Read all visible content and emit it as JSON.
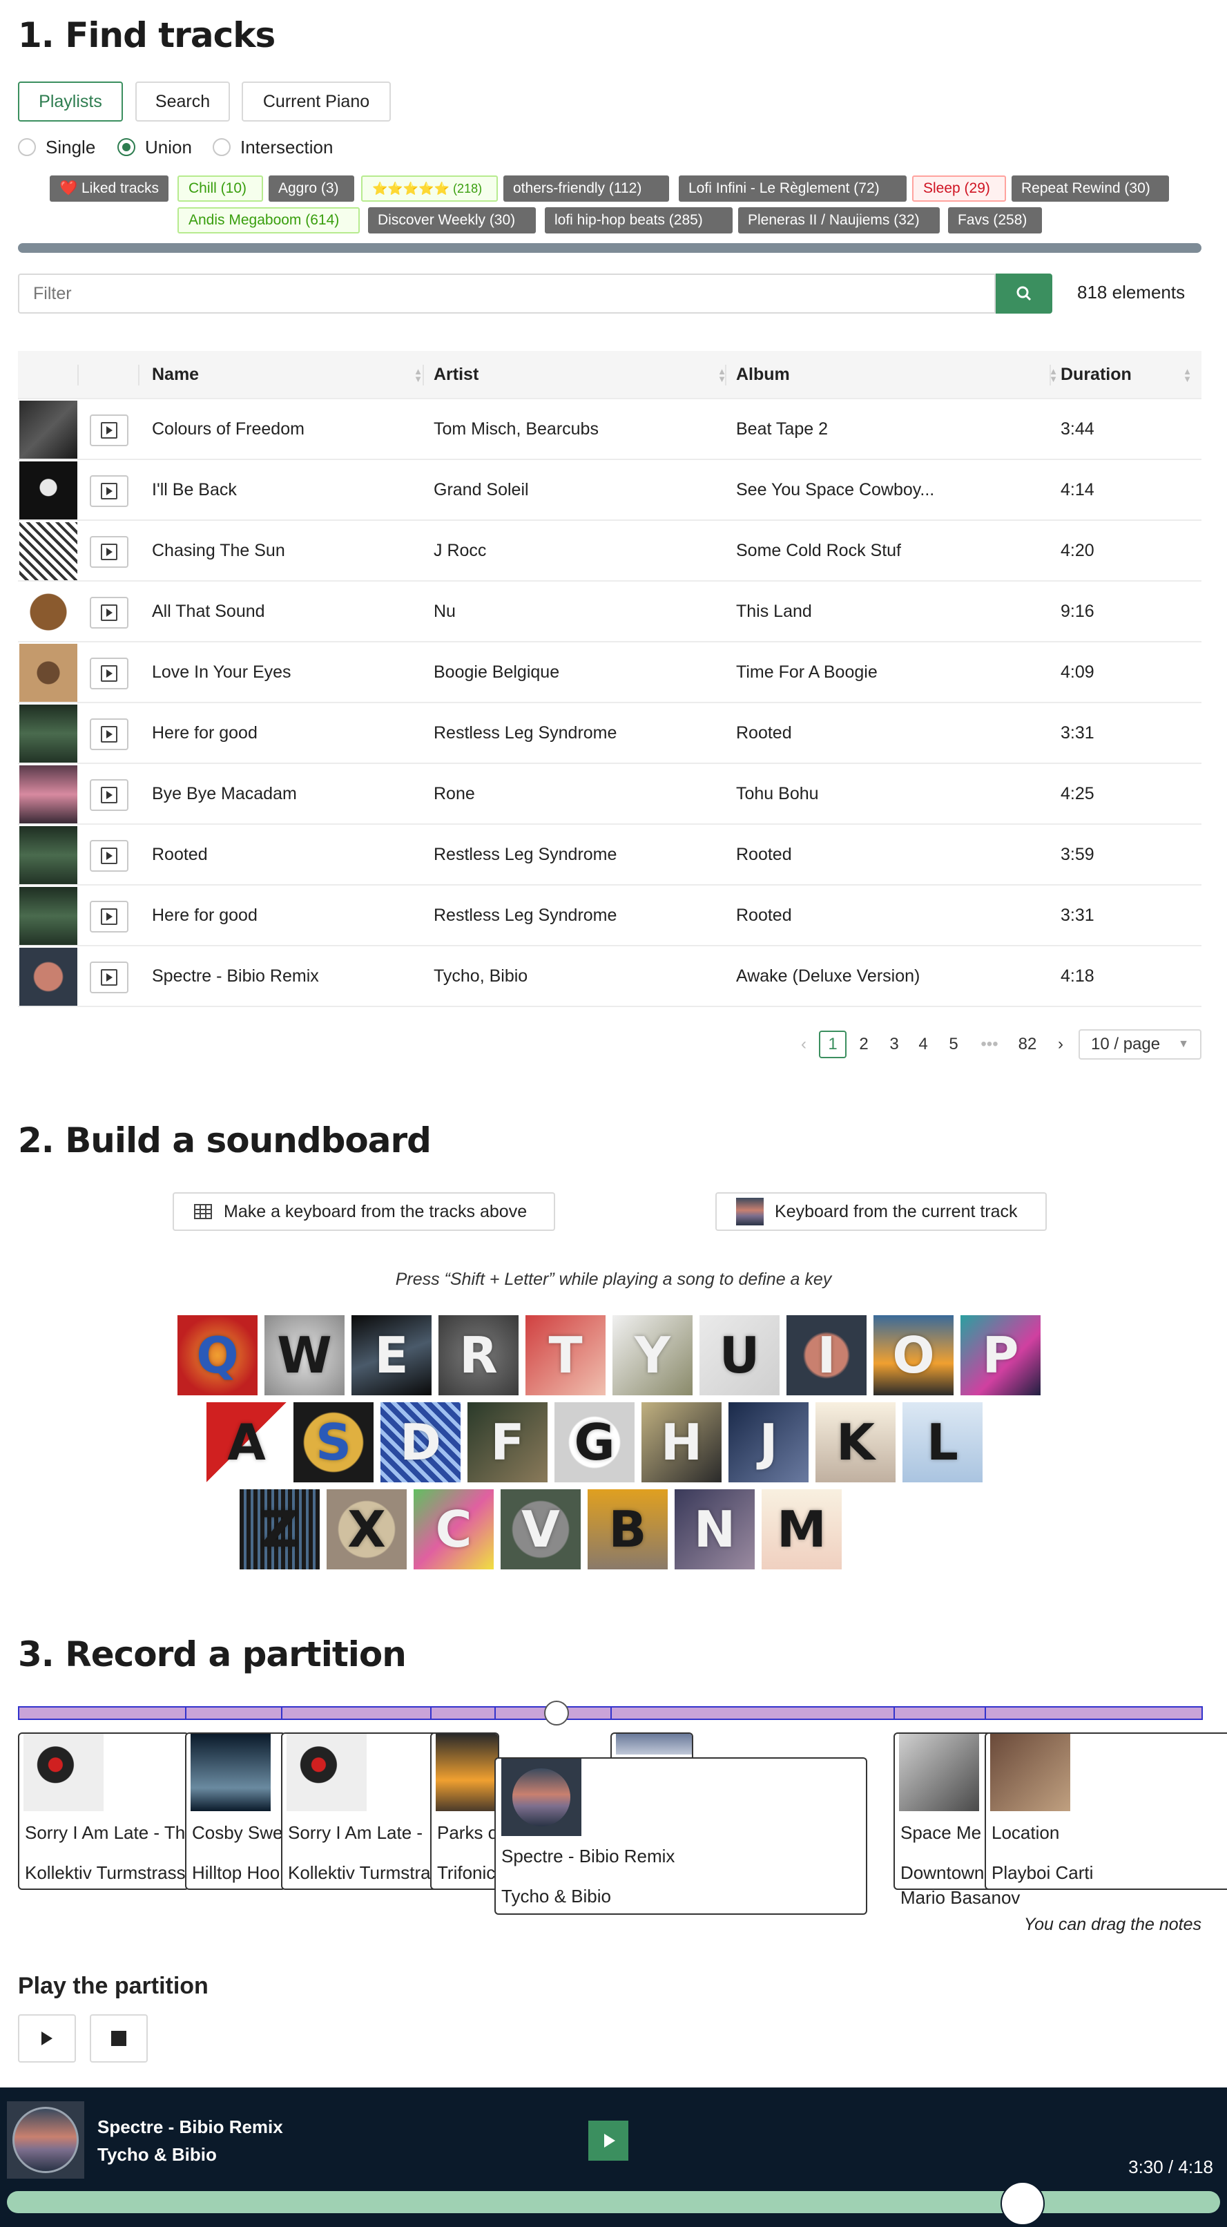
{
  "find": {
    "title": "1. Find tracks",
    "tabs": [
      "Playlists",
      "Search",
      "Current Piano"
    ],
    "modes": [
      "Single",
      "Union",
      "Intersection"
    ],
    "selected_mode": "Union",
    "tags": [
      "❤️ Liked tracks",
      "Chill (10)",
      "Aggro (3)",
      "⭐⭐⭐⭐⭐ (218)",
      "others-friendly (112)",
      "Lofi Infini - Le Règlement (72)",
      "Sleep (29)",
      "Repeat Rewind (30)",
      "Andis Megaboom (614)",
      "Discover Weekly (30)",
      "lofi hip-hop beats (285)",
      "Pleneras II / Naujiems (32)",
      "Favs (258)"
    ],
    "filter_placeholder": "Filter",
    "count": "818 elements",
    "columns": [
      "Name",
      "Artist",
      "Album",
      "Duration"
    ],
    "rows": [
      {
        "name": "Colours of Freedom",
        "artist": "Tom Misch, Bearcubs",
        "album": "Beat Tape 2",
        "duration": "3:44"
      },
      {
        "name": "I'll Be Back",
        "artist": "Grand Soleil",
        "album": "See You Space Cowboy...",
        "duration": "4:14"
      },
      {
        "name": "Chasing The Sun",
        "artist": "J Rocc",
        "album": "Some Cold Rock Stuf",
        "duration": "4:20"
      },
      {
        "name": "All That Sound",
        "artist": "Nu",
        "album": "This Land",
        "duration": "9:16"
      },
      {
        "name": "Love In Your Eyes",
        "artist": "Boogie Belgique",
        "album": "Time For A Boogie",
        "duration": "4:09"
      },
      {
        "name": "Here for good",
        "artist": "Restless Leg Syndrome",
        "album": "Rooted",
        "duration": "3:31"
      },
      {
        "name": "Bye Bye Macadam",
        "artist": "Rone",
        "album": "Tohu Bohu",
        "duration": "4:25"
      },
      {
        "name": "Rooted",
        "artist": "Restless Leg Syndrome",
        "album": "Rooted",
        "duration": "3:59"
      },
      {
        "name": "Here for good",
        "artist": "Restless Leg Syndrome",
        "album": "Rooted",
        "duration": "3:31"
      },
      {
        "name": "Spectre - Bibio Remix",
        "artist": "Tycho, Bibio",
        "album": "Awake (Deluxe Version)",
        "duration": "4:18"
      }
    ],
    "pagination": {
      "pages": [
        "1",
        "2",
        "3",
        "4",
        "5",
        "•••",
        "82"
      ],
      "current": "1",
      "page_size": "10 / page"
    }
  },
  "soundboard": {
    "title": "2. Build a soundboard",
    "make_keyboard_label": "Make a keyboard from the tracks above",
    "keyboard_current_label": "Keyboard from the current track",
    "hint": "Press “Shift + Letter” while playing a song to define a key",
    "rows": [
      [
        "Q",
        "W",
        "E",
        "R",
        "T",
        "Y",
        "U",
        "I",
        "O",
        "P"
      ],
      [
        "A",
        "S",
        "D",
        "F",
        "G",
        "H",
        "J",
        "K",
        "L"
      ],
      [
        "Z",
        "X",
        "C",
        "V",
        "B",
        "N",
        "M"
      ]
    ]
  },
  "partition": {
    "title": "3. Record a partition",
    "notes": [
      {
        "title": "Sorry I Am Late - Th",
        "artist": "Kollektiv Turmstrass"
      },
      {
        "title": "Cosby Swe",
        "artist": "Hilltop Hoo"
      },
      {
        "title": "Sorry I Am Late -",
        "artist": "Kollektiv Turmstra"
      },
      {
        "title": "Parks o",
        "artist": "Trifonic"
      },
      {
        "title": "Space Me",
        "artist": "Downtown",
        "extra": "Mario Basanov"
      },
      {
        "title": "Location",
        "artist": "Playboi Carti"
      }
    ],
    "popup": {
      "title": "Spectre - Bibio Remix",
      "artist": "Tycho & Bibio"
    },
    "drag_hint": "You can drag the notes",
    "play_title": "Play the partition"
  },
  "player": {
    "title": "Spectre - Bibio Remix",
    "artist": "Tycho & Bibio",
    "time": "3:30 / 4:18",
    "progress": 0.837
  },
  "colors": {
    "accent": "#3b8f5f",
    "player_bg": "#0b1a2a",
    "progress": "#9fd1b3"
  }
}
